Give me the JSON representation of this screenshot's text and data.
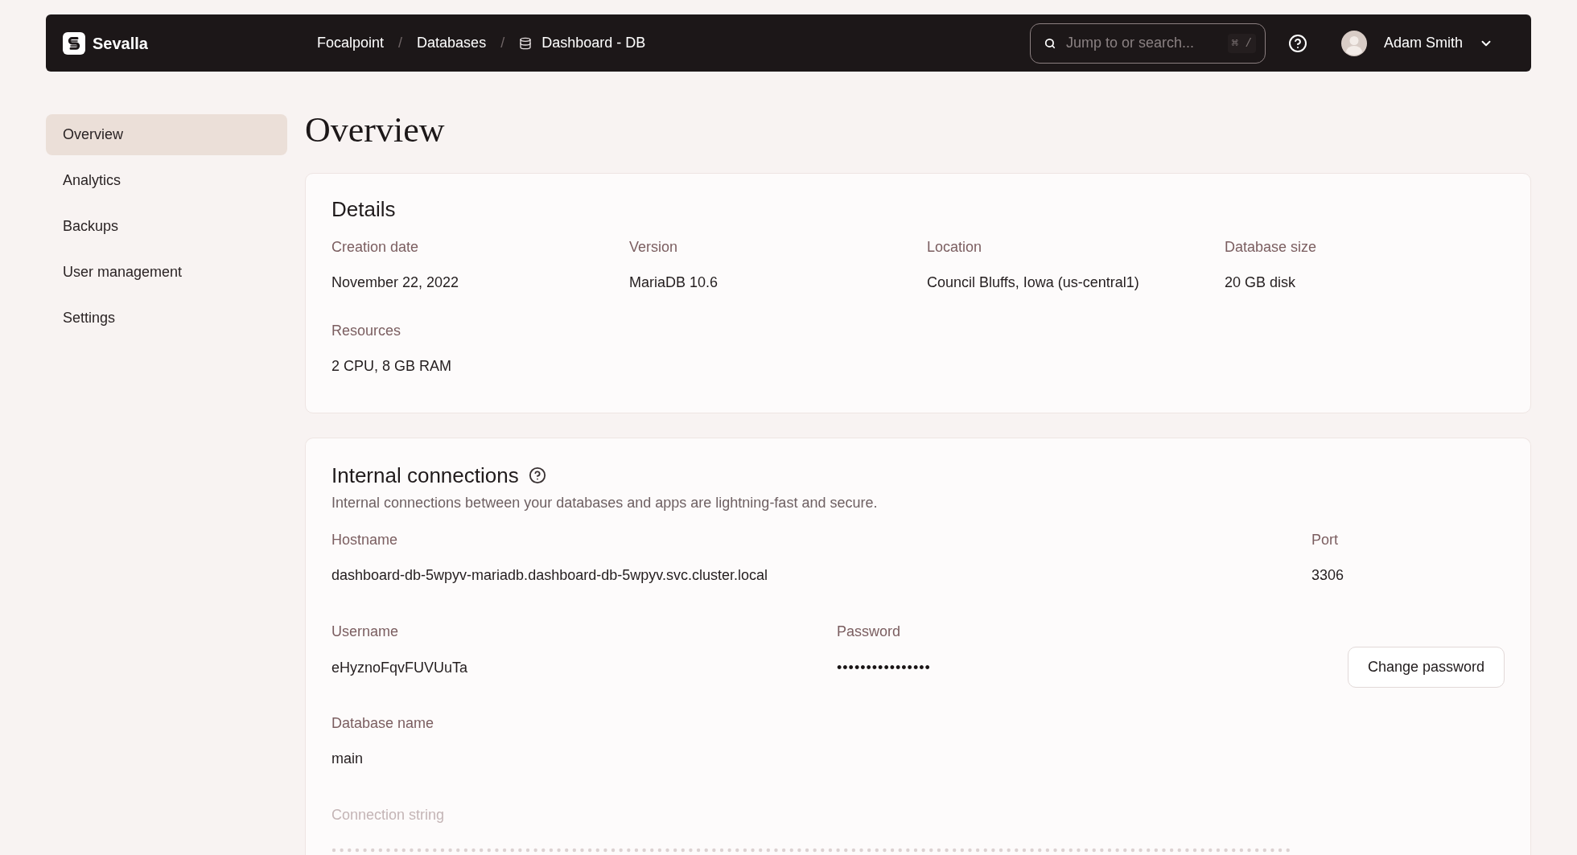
{
  "top_bar": {
    "brand": "Sevalla",
    "breadcrumbs": [
      {
        "kind": "link",
        "label": "Focalpoint"
      },
      {
        "kind": "link",
        "separator": "/",
        "label": "Databases"
      },
      {
        "kind": "current",
        "separator": "/",
        "label": "Dashboard - DB"
      }
    ],
    "search": {
      "placeholder": "Jump to or search...",
      "shortcut": "⌘ /"
    },
    "user": {
      "name": "Adam Smith"
    }
  },
  "sidebar": {
    "items": [
      {
        "label": "Overview",
        "selected": true
      },
      {
        "label": "Analytics",
        "selected": false
      },
      {
        "label": "Backups",
        "selected": false
      },
      {
        "label": "User management",
        "selected": false
      },
      {
        "label": "Settings",
        "selected": false
      }
    ]
  },
  "page_title": "Overview",
  "details": {
    "title": "Details",
    "fields": [
      {
        "label": "Creation date",
        "value": "November 22, 2022"
      },
      {
        "label": "Version",
        "value": "MariaDB 10.6"
      },
      {
        "label": "Location",
        "value": "Council Bluffs, Iowa (us-central1)"
      },
      {
        "label": "Database size",
        "value": "20 GB disk"
      },
      {
        "label": "Resources",
        "value": "2 CPU, 8 GB RAM"
      }
    ]
  },
  "internal_connections": {
    "title": "Internal connections",
    "description": "Internal connections between your databases and apps are lightning-fast and secure.",
    "hostname": {
      "label": "Hostname",
      "value": "dashboard-db-5wpyv-mariadb.dashboard-db-5wpyv.svc.cluster.local"
    },
    "port": {
      "label": "Port",
      "value": "3306"
    },
    "username": {
      "label": "Username",
      "value": "eHyznoFqvFUVUuTa"
    },
    "password": {
      "label": "Password",
      "value": "••••••••••••••••"
    },
    "change_password_button": "Change password",
    "database_name": {
      "label": "Database name",
      "value": "main"
    },
    "connection_string": {
      "label": "Connection string"
    }
  }
}
